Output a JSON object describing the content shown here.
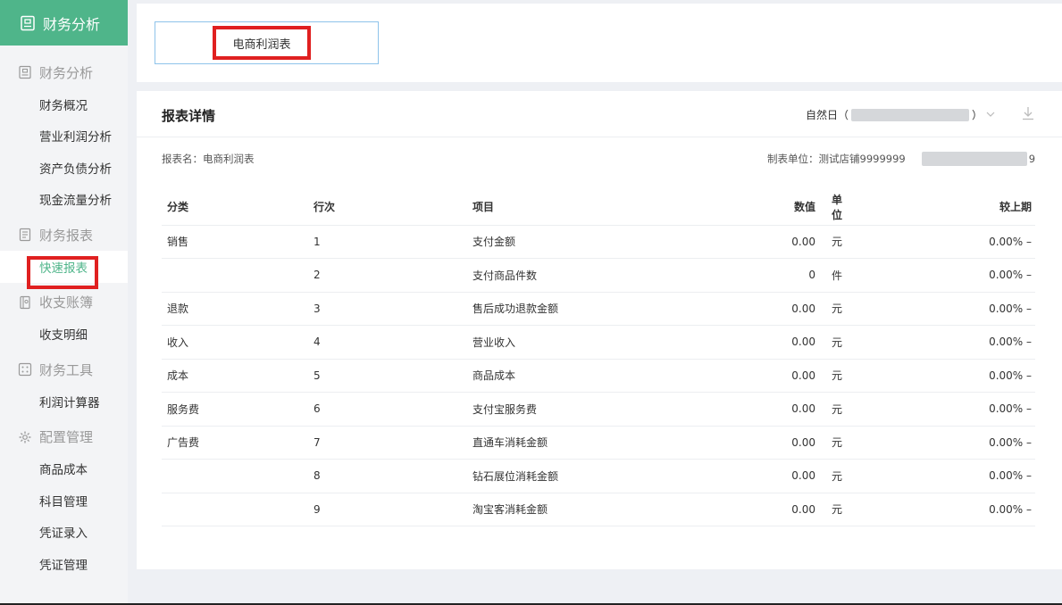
{
  "sidebar": {
    "header": "财务分析",
    "groups": [
      {
        "title": "财务分析",
        "icon": "building-icon",
        "items": [
          "财务概况",
          "营业利润分析",
          "资产负债分析",
          "现金流量分析"
        ]
      },
      {
        "title": "财务报表",
        "icon": "report-icon",
        "items": [
          "快速报表"
        ]
      },
      {
        "title": "收支账簿",
        "icon": "ledger-icon",
        "items": [
          "收支明细"
        ]
      },
      {
        "title": "财务工具",
        "icon": "tools-icon",
        "items": [
          "利润计算器"
        ]
      },
      {
        "title": "配置管理",
        "icon": "gear-icon",
        "items": [
          "商品成本",
          "科目管理",
          "凭证录入",
          "凭证管理"
        ]
      }
    ],
    "active_item": "快速报表"
  },
  "top_tab": {
    "label": "电商利润表"
  },
  "report": {
    "title": "报表详情",
    "date_prefix": "自然日（",
    "date_suffix": "）",
    "name_label": "报表名：电商利润表",
    "unit_label": "制表单位：测试店铺9999999",
    "unit_suffix": "9",
    "columns": {
      "category": "分类",
      "line": "行次",
      "item": "项目",
      "value": "数值",
      "unit": "单位",
      "change": "较上期"
    },
    "rows": [
      {
        "category": "销售",
        "line": "1",
        "item": "支付金额",
        "value": "0.00",
        "unit": "元",
        "change": "0.00% –"
      },
      {
        "category": "",
        "line": "2",
        "item": "支付商品件数",
        "value": "0",
        "unit": "件",
        "change": "0.00% –"
      },
      {
        "category": "退款",
        "line": "3",
        "item": "售后成功退款金额",
        "value": "0.00",
        "unit": "元",
        "change": "0.00% –"
      },
      {
        "category": "收入",
        "line": "4",
        "item": "营业收入",
        "value": "0.00",
        "unit": "元",
        "change": "0.00% –"
      },
      {
        "category": "成本",
        "line": "5",
        "item": "商品成本",
        "value": "0.00",
        "unit": "元",
        "change": "0.00% –"
      },
      {
        "category": "服务费",
        "line": "6",
        "item": "支付宝服务费",
        "value": "0.00",
        "unit": "元",
        "change": "0.00% –"
      },
      {
        "category": "广告费",
        "line": "7",
        "item": "直通车消耗金额",
        "value": "0.00",
        "unit": "元",
        "change": "0.00% –"
      },
      {
        "category": "",
        "line": "8",
        "item": "钻石展位消耗金额",
        "value": "0.00",
        "unit": "元",
        "change": "0.00% –"
      },
      {
        "category": "",
        "line": "9",
        "item": "淘宝客消耗金额",
        "value": "0.00",
        "unit": "元",
        "change": "0.00% –"
      }
    ]
  },
  "colors": {
    "accent": "#4fb58a",
    "highlight": "#e02020"
  }
}
